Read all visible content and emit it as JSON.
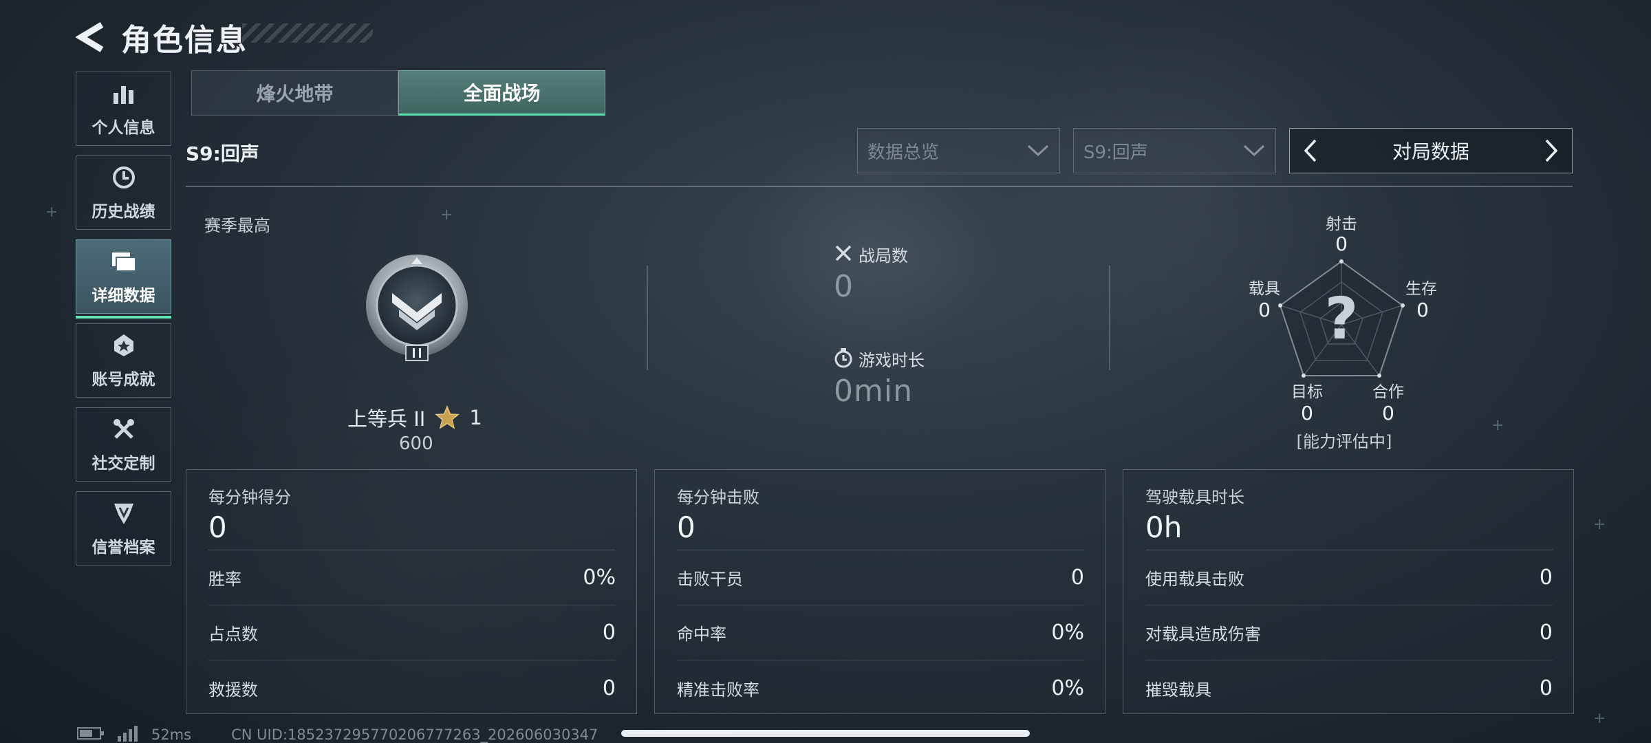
{
  "header": {
    "title": "角色信息"
  },
  "sidebar": {
    "items": [
      {
        "label": "个人信息",
        "icon": "bar-chart-icon",
        "active": false
      },
      {
        "label": "历史战绩",
        "icon": "history-clock-icon",
        "active": false
      },
      {
        "label": "详细数据",
        "icon": "folder-data-icon",
        "active": true
      },
      {
        "label": "账号成就",
        "icon": "achievement-medal-icon",
        "active": false
      },
      {
        "label": "社交定制",
        "icon": "tools-wrench-icon",
        "active": false
      },
      {
        "label": "信誉档案",
        "icon": "credit-shield-icon",
        "active": false
      }
    ]
  },
  "mode_tabs": [
    {
      "label": "烽火地带",
      "active": false
    },
    {
      "label": "全面战场",
      "active": true
    }
  ],
  "season_label": "S9:回声",
  "filters": {
    "data_type": "数据总览",
    "season": "S9:回声",
    "stat_view": "对局数据"
  },
  "rank": {
    "section_label": "赛季最高",
    "name": "上等兵 II",
    "stars": "1",
    "points": "600"
  },
  "summary": {
    "matches_label": "战局数",
    "matches_value": "0",
    "playtime_label": "游戏时长",
    "playtime_value": "0min"
  },
  "radar": {
    "shooting_label": "射击",
    "shooting_value": "0",
    "survival_label": "生存",
    "survival_value": "0",
    "cooperation_label": "合作",
    "cooperation_value": "0",
    "objective_label": "目标",
    "objective_value": "0",
    "vehicle_label": "载具",
    "vehicle_value": "0",
    "status": "[能力评估中]"
  },
  "panels": [
    {
      "title": "每分钟得分",
      "value": "0",
      "rows": [
        {
          "label": "胜率",
          "value": "0%"
        },
        {
          "label": "占点数",
          "value": "0"
        },
        {
          "label": "救援数",
          "value": "0"
        }
      ]
    },
    {
      "title": "每分钟击败",
      "value": "0",
      "rows": [
        {
          "label": "击败干员",
          "value": "0"
        },
        {
          "label": "命中率",
          "value": "0%"
        },
        {
          "label": "精准击败率",
          "value": "0%"
        }
      ]
    },
    {
      "title": "驾驶载具时长",
      "value": "0h",
      "rows": [
        {
          "label": "使用载具击败",
          "value": "0"
        },
        {
          "label": "对载具造成伤害",
          "value": "0"
        },
        {
          "label": "摧毁载具",
          "value": "0"
        }
      ]
    }
  ],
  "footer": {
    "ping": "52ms",
    "uid": "CN UID:185237295770206777263_202606030347"
  },
  "colors": {
    "accent": "#5fe3b5",
    "active_tab": "#4f7a74",
    "background": "#222c34"
  }
}
